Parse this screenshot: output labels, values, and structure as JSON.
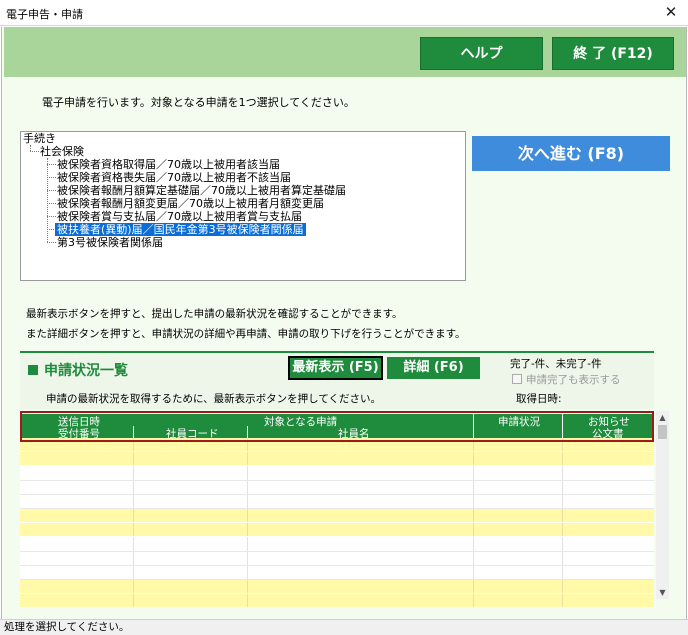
{
  "window": {
    "title": "電子申告・申請",
    "close_glyph": "✕"
  },
  "header": {
    "help_label": "ヘルプ",
    "exit_label": "終 了 (F12)"
  },
  "instruction": "電子申請を行います。対象となる申請を1つ選択してください。",
  "tree": {
    "root": "手続き",
    "group": "社会保険",
    "items": [
      "被保険者資格取得届／70歳以上被用者該当届",
      "被保険者資格喪失届／70歳以上被用者不該当届",
      "被保険者報酬月額算定基礎届／70歳以上被用者算定基礎届",
      "被保険者報酬月額変更届／70歳以上被用者月額変更届",
      "被保険者賞与支払届／70歳以上被用者賞与支払届",
      "被扶養者(異動)届／国民年金第3号被保険者関係届",
      "第3号被保険者関係届"
    ],
    "selected_index": 5
  },
  "next_button": "次へ進む (F8)",
  "info": {
    "line1": "最新表示ボタンを押すと、提出した申請の最新状況を確認することができます。",
    "line2": "また詳細ボタンを押すと、申請状況の詳細や再申請、申請の取り下げを行うことができます。"
  },
  "status_panel": {
    "title": "申請状況一覧",
    "refresh_label": "最新表示 (F5)",
    "detail_label": "詳細 (F6)",
    "counts": "完了-件、未完了-件",
    "show_completed_label": "申請完了も表示する",
    "note": "申請の最新状況を取得するために、最新表示ボタンを押してください。",
    "acquired_label": "取得日時:"
  },
  "table": {
    "headers_top": [
      "送信日時",
      "対象となる申請",
      "申請状況",
      "お知らせ"
    ],
    "headers_bottom": [
      "受付番号",
      "社員コード",
      "社員名",
      "公文書"
    ],
    "row_pattern": [
      "yellow",
      "yellow",
      "white",
      "white",
      "white",
      "yellow",
      "yellow",
      "white",
      "white",
      "white",
      "yellow",
      "yellow"
    ]
  },
  "statusbar": "処理を選択してください。"
}
